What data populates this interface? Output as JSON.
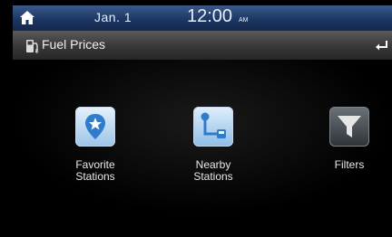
{
  "status": {
    "date": "Jan.  1",
    "time": "12:00",
    "ampm": "AM",
    "home_icon": "home-icon"
  },
  "header": {
    "title": "Fuel Prices",
    "title_icon": "fuel-pump-icon",
    "back_icon": "back-icon"
  },
  "menu": [
    {
      "label1": "Favorite",
      "label2": "Stations",
      "icon": "favorite-station-icon"
    },
    {
      "label1": "Nearby",
      "label2": "Stations",
      "icon": "nearby-stations-icon"
    },
    {
      "label1": "Filters",
      "label2": "",
      "icon": "filter-icon"
    }
  ],
  "colors": {
    "status_bar": "#1d3763",
    "title_bar": "#3a3a3a",
    "icon_blue": "#3a7fc4",
    "background": "#000000"
  }
}
